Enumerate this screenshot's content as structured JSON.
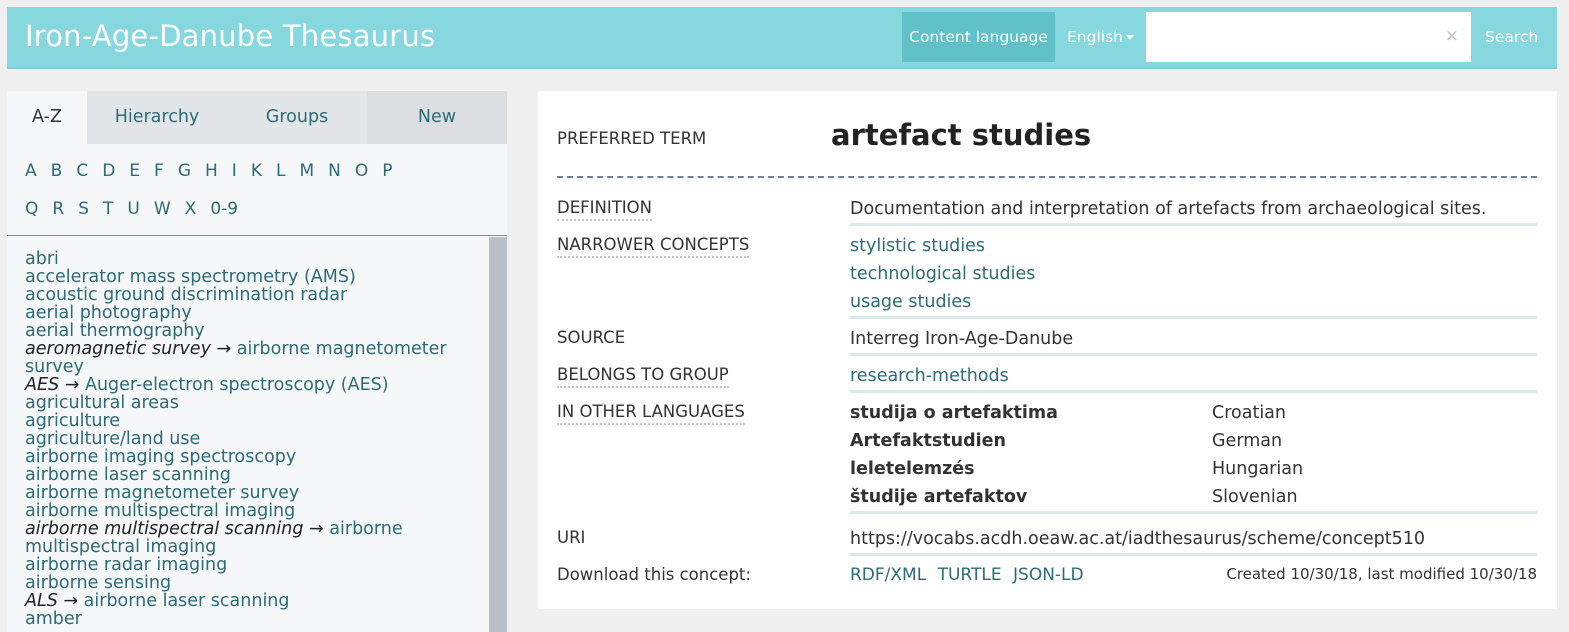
{
  "header": {
    "title": "Iron-Age-Danube Thesaurus",
    "content_language_label": "Content language",
    "language_selected": "English",
    "search_value": "",
    "search_placeholder": "",
    "clear_icon": "×",
    "search_button": "Search"
  },
  "sidebar": {
    "tabs": [
      {
        "label": "A-Z",
        "active": true
      },
      {
        "label": "Hierarchy",
        "active": false
      },
      {
        "label": "Groups",
        "active": false
      },
      {
        "label": "New",
        "active": false
      }
    ],
    "letters_row1": [
      "A",
      "B",
      "C",
      "D",
      "E",
      "F",
      "G",
      "H",
      "I",
      "K",
      "L",
      "M",
      "N",
      "O",
      "P"
    ],
    "letters_row2": [
      "Q",
      "R",
      "S",
      "T",
      "U",
      "W",
      "X",
      "0-9"
    ],
    "items": [
      {
        "term": "abri"
      },
      {
        "term": "accelerator mass spectrometry (AMS)"
      },
      {
        "term": "acoustic ground discrimination radar"
      },
      {
        "term": "aerial photography"
      },
      {
        "term": "aerial thermography"
      },
      {
        "alt": "aeromagnetic survey",
        "term": "airborne magnetometer survey"
      },
      {
        "alt": "AES",
        "term": "Auger-electron spectroscopy (AES)"
      },
      {
        "term": "agricultural areas"
      },
      {
        "term": "agriculture"
      },
      {
        "term": "agriculture/land use"
      },
      {
        "term": "airborne imaging spectroscopy"
      },
      {
        "term": "airborne laser scanning"
      },
      {
        "term": "airborne magnetometer survey"
      },
      {
        "term": "airborne multispectral imaging"
      },
      {
        "alt": "airborne multispectral scanning",
        "term": "airborne multispectral imaging"
      },
      {
        "term": "airborne radar imaging"
      },
      {
        "term": "airborne sensing"
      },
      {
        "alt": "ALS",
        "term": "airborne laser scanning"
      },
      {
        "term": "amber"
      }
    ],
    "arrow": "→"
  },
  "concept": {
    "preferred_term_label": "PREFERRED TERM",
    "preferred_term": "artefact studies",
    "definition_label": "DEFINITION",
    "definition": "Documentation and interpretation of artefacts from archaeological sites.",
    "narrower_label": "NARROWER CONCEPTS",
    "narrower": [
      "stylistic studies",
      "technological studies",
      "usage studies"
    ],
    "source_label": "SOURCE",
    "source": "Interreg Iron-Age-Danube",
    "group_label": "BELONGS TO GROUP",
    "group": "research-methods",
    "other_lang_label": "IN OTHER LANGUAGES",
    "other_languages": [
      {
        "term": "studija o artefaktima",
        "language": "Croatian"
      },
      {
        "term": "Artefaktstudien",
        "language": "German"
      },
      {
        "term": "leletelemzés",
        "language": "Hungarian"
      },
      {
        "term": "študije artefaktov",
        "language": "Slovenian"
      }
    ],
    "uri_label": "URI",
    "uri": "https://vocabs.acdh.oeaw.ac.at/iadthesaurus/scheme/concept510",
    "download_label": "Download this concept:",
    "download_formats": [
      "RDF/XML",
      "TURTLE",
      "JSON-LD"
    ],
    "meta": "Created 10/30/18, last modified 10/30/18"
  }
}
